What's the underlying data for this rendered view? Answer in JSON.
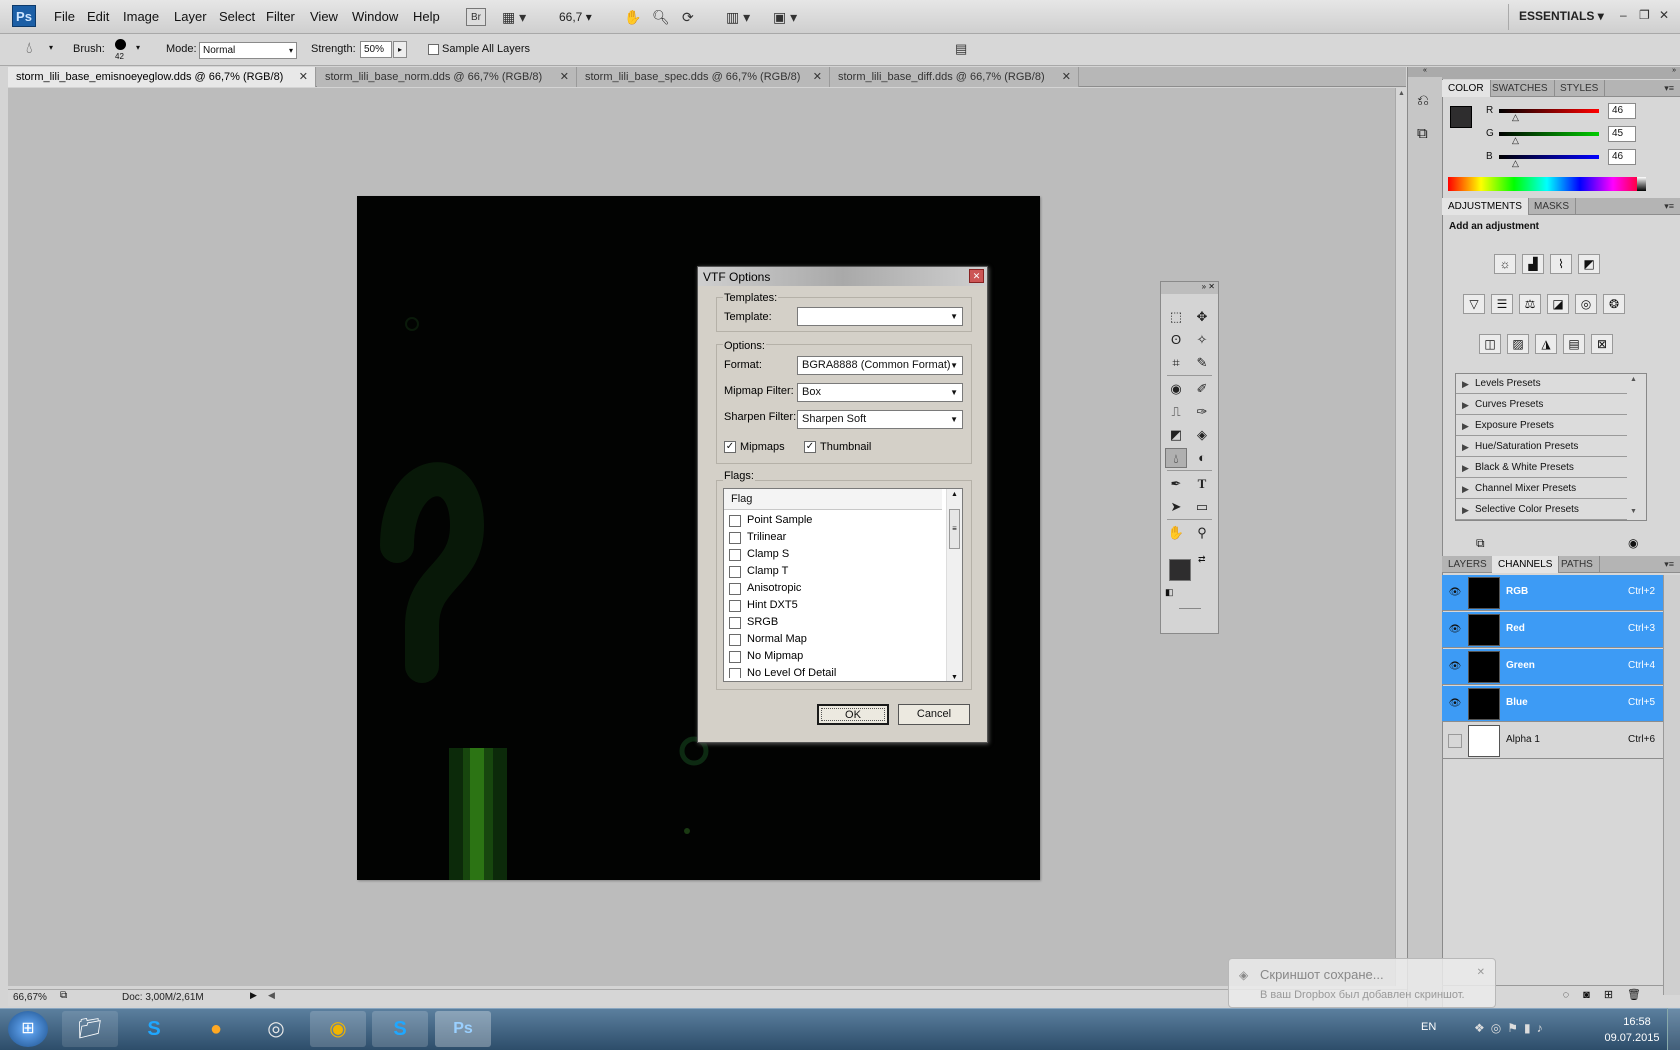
{
  "app": {
    "logo": "Ps"
  },
  "menu": [
    "File",
    "Edit",
    "Image",
    "Layer",
    "Select",
    "Filter",
    "View",
    "Window",
    "Help"
  ],
  "menubar": {
    "bridge": "Br",
    "zoom": "66,7",
    "workspace": "ESSENTIALS"
  },
  "options": {
    "brush_label": "Brush:",
    "brush_size": "42",
    "mode_label": "Mode:",
    "mode_value": "Normal",
    "strength_label": "Strength:",
    "strength_value": "50%",
    "sample_all_layers": "Sample All Layers"
  },
  "tabs": [
    {
      "label": "storm_lili_base_emisnoeyeglow.dds @ 66,7% (RGB/8)"
    },
    {
      "label": "storm_lili_base_norm.dds @ 66,7% (RGB/8)"
    },
    {
      "label": "storm_lili_base_spec.dds @ 66,7% (RGB/8)"
    },
    {
      "label": "storm_lili_base_diff.dds @ 66,7% (RGB/8)"
    }
  ],
  "status": {
    "zoom": "66,67%",
    "doc": "Doc: 3,00M/2,61M"
  },
  "color_panel": {
    "tabs": [
      "COLOR",
      "SWATCHES",
      "STYLES"
    ],
    "r_label": "R",
    "g_label": "G",
    "b_label": "B",
    "r": "46",
    "g": "45",
    "b": "46",
    "swatch_color": "#2e2d2e"
  },
  "adjustments": {
    "tabs": [
      "ADJUSTMENTS",
      "MASKS"
    ],
    "heading": "Add an adjustment",
    "presets": [
      "Levels Presets",
      "Curves Presets",
      "Exposure Presets",
      "Hue/Saturation Presets",
      "Black & White Presets",
      "Channel Mixer Presets",
      "Selective Color Presets"
    ]
  },
  "layers_panel": {
    "tabs": [
      "LAYERS",
      "CHANNELS",
      "PATHS"
    ],
    "channels": [
      {
        "name": "RGB",
        "key": "Ctrl+2"
      },
      {
        "name": "Red",
        "key": "Ctrl+3"
      },
      {
        "name": "Green",
        "key": "Ctrl+4"
      },
      {
        "name": "Blue",
        "key": "Ctrl+5"
      },
      {
        "name": "Alpha 1",
        "key": "Ctrl+6"
      }
    ]
  },
  "dialog": {
    "title": "VTF Options",
    "templates_group": "Templates:",
    "template_label": "Template:",
    "template_value": "",
    "options_group": "Options:",
    "format_label": "Format:",
    "format_value": "BGRA8888 (Common Format)",
    "mipmap_label": "Mipmap Filter:",
    "mipmap_value": "Box",
    "sharpen_label": "Sharpen Filter:",
    "sharpen_value": "Sharpen Soft",
    "mipmaps_cb": "Mipmaps",
    "thumbnail_cb": "Thumbnail",
    "flags_group": "Flags:",
    "flag_header": "Flag",
    "flags": [
      "Point Sample",
      "Trilinear",
      "Clamp S",
      "Clamp T",
      "Anisotropic",
      "Hint DXT5",
      "SRGB",
      "Normal Map",
      "No Mipmap",
      "No Level Of Detail"
    ],
    "ok": "OK",
    "cancel": "Cancel"
  },
  "notification": {
    "title": "Скриншот сохране...",
    "body": "В ваш Dropbox был добавлен скриншот."
  },
  "taskbar": {
    "lang": "EN",
    "time": "16:58",
    "date": "09.07.2015"
  },
  "accent_color": "#3d9bf5"
}
